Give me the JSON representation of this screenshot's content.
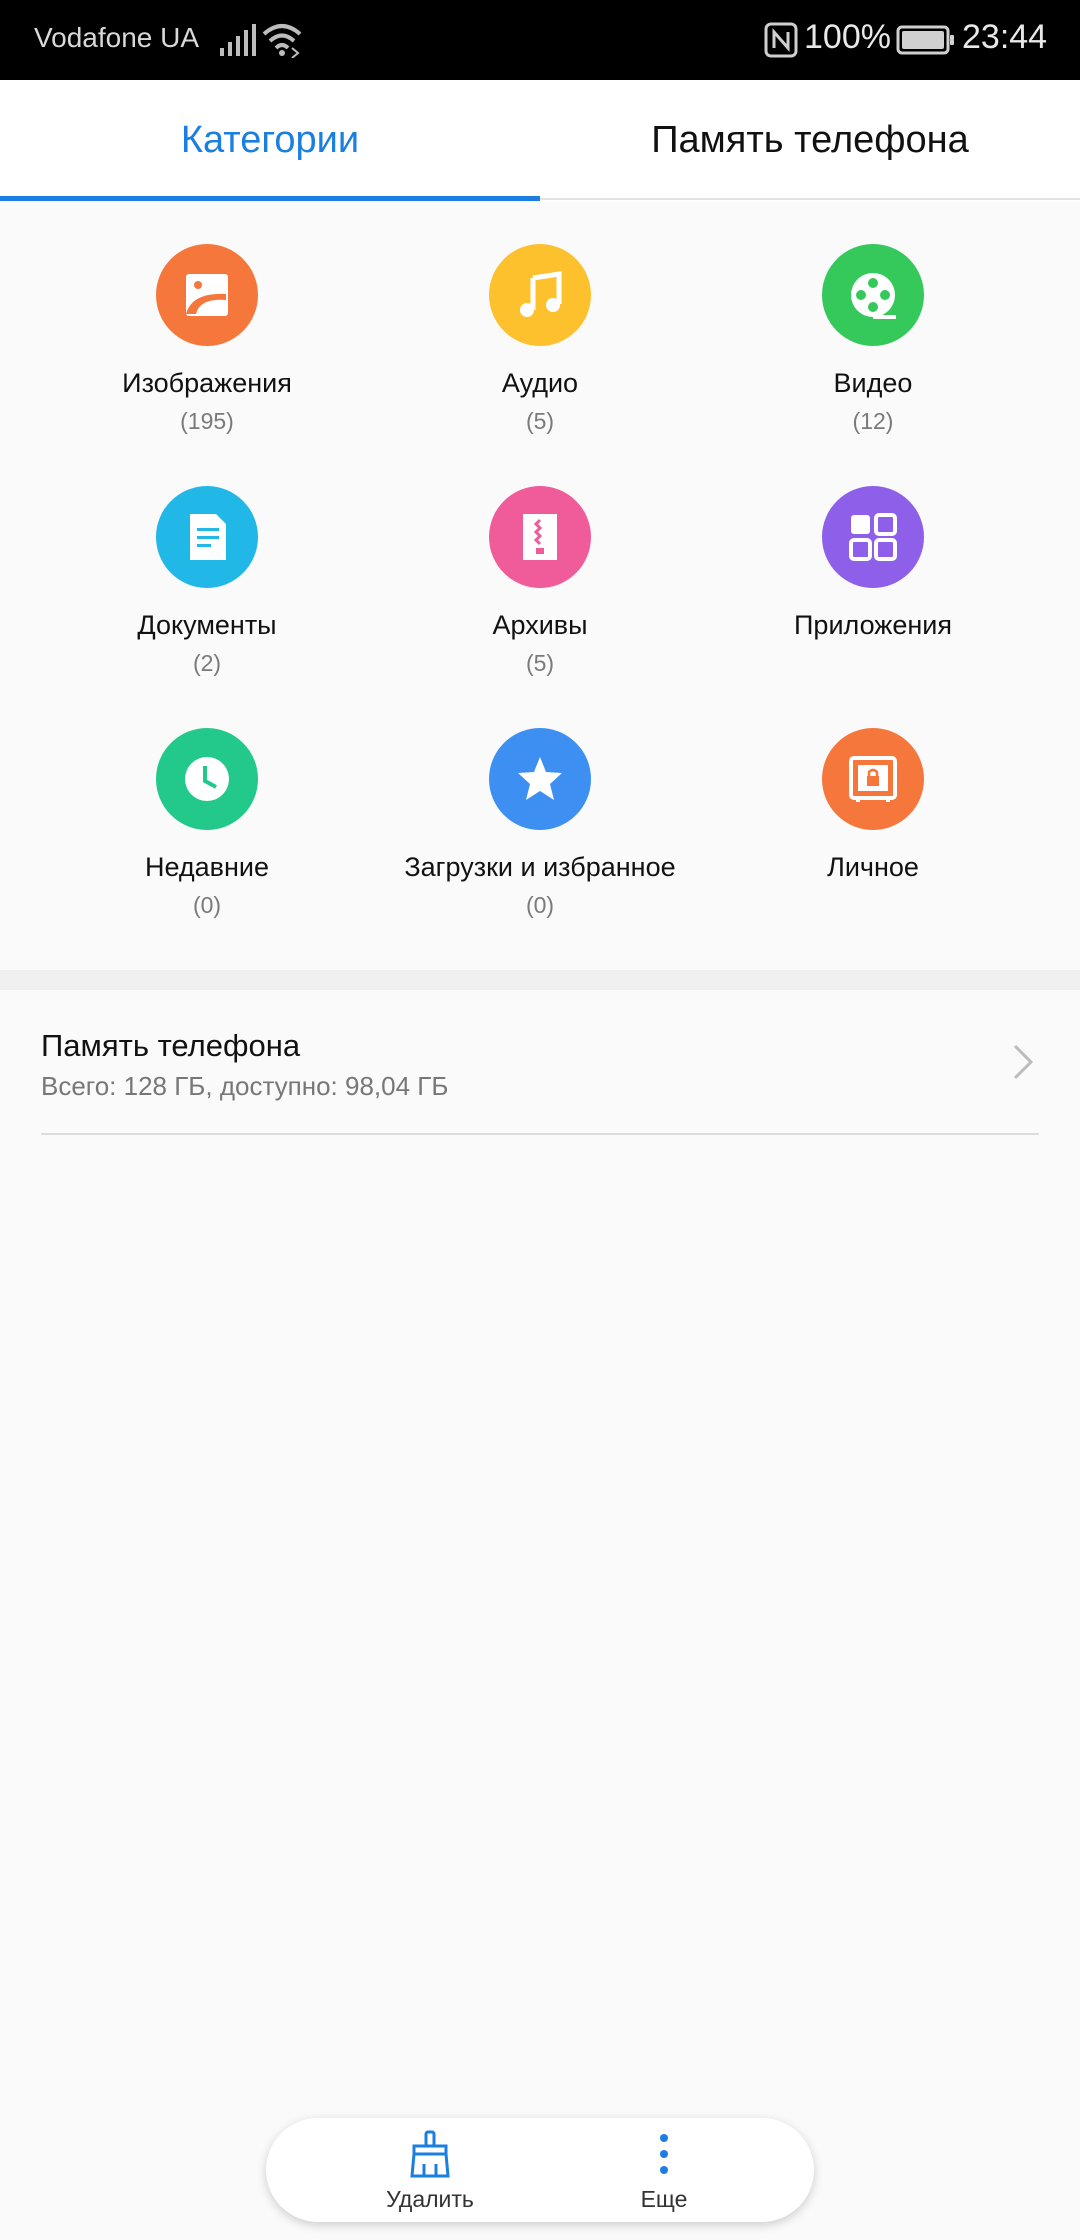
{
  "status_bar": {
    "carrier": "Vodafone UA",
    "battery_percent": "100%",
    "time": "23:44",
    "icons": [
      "signal-icon",
      "wifi-icon",
      "nfc-icon",
      "battery-icon"
    ]
  },
  "tabs": [
    {
      "label": "Категории",
      "active": true
    },
    {
      "label": "Память телефона",
      "active": false
    }
  ],
  "accent_color": "#1a7fe0",
  "categories": [
    {
      "label": "Изображения",
      "count": "(195)",
      "icon": "image-icon",
      "color": "#f5773b"
    },
    {
      "label": "Аудио",
      "count": "(5)",
      "icon": "music-note-icon",
      "color": "#fdc12e"
    },
    {
      "label": "Видео",
      "count": "(12)",
      "icon": "film-reel-icon",
      "color": "#35c95c"
    },
    {
      "label": "Документы",
      "count": "(2)",
      "icon": "document-icon",
      "color": "#21b8e7"
    },
    {
      "label": "Архивы",
      "count": "(5)",
      "icon": "archive-icon",
      "color": "#f05b9a"
    },
    {
      "label": "Приложения",
      "count": "",
      "icon": "apps-grid-icon",
      "color": "#8e5fe8"
    },
    {
      "label": "Недавние",
      "count": "(0)",
      "icon": "clock-icon",
      "color": "#22c98b"
    },
    {
      "label": "Загрузки и избранное",
      "count": "(0)",
      "icon": "star-icon",
      "color": "#3d8ff2"
    },
    {
      "label": "Личное",
      "count": "",
      "icon": "safe-lock-icon",
      "color": "#f5773b"
    }
  ],
  "storage": {
    "title": "Память телефона",
    "subtitle": "Всего: 128 ГБ, доступно: 98,04 ГБ"
  },
  "bottom_actions": [
    {
      "label": "Удалить",
      "icon": "broom-icon"
    },
    {
      "label": "Еще",
      "icon": "more-vertical-icon"
    }
  ]
}
